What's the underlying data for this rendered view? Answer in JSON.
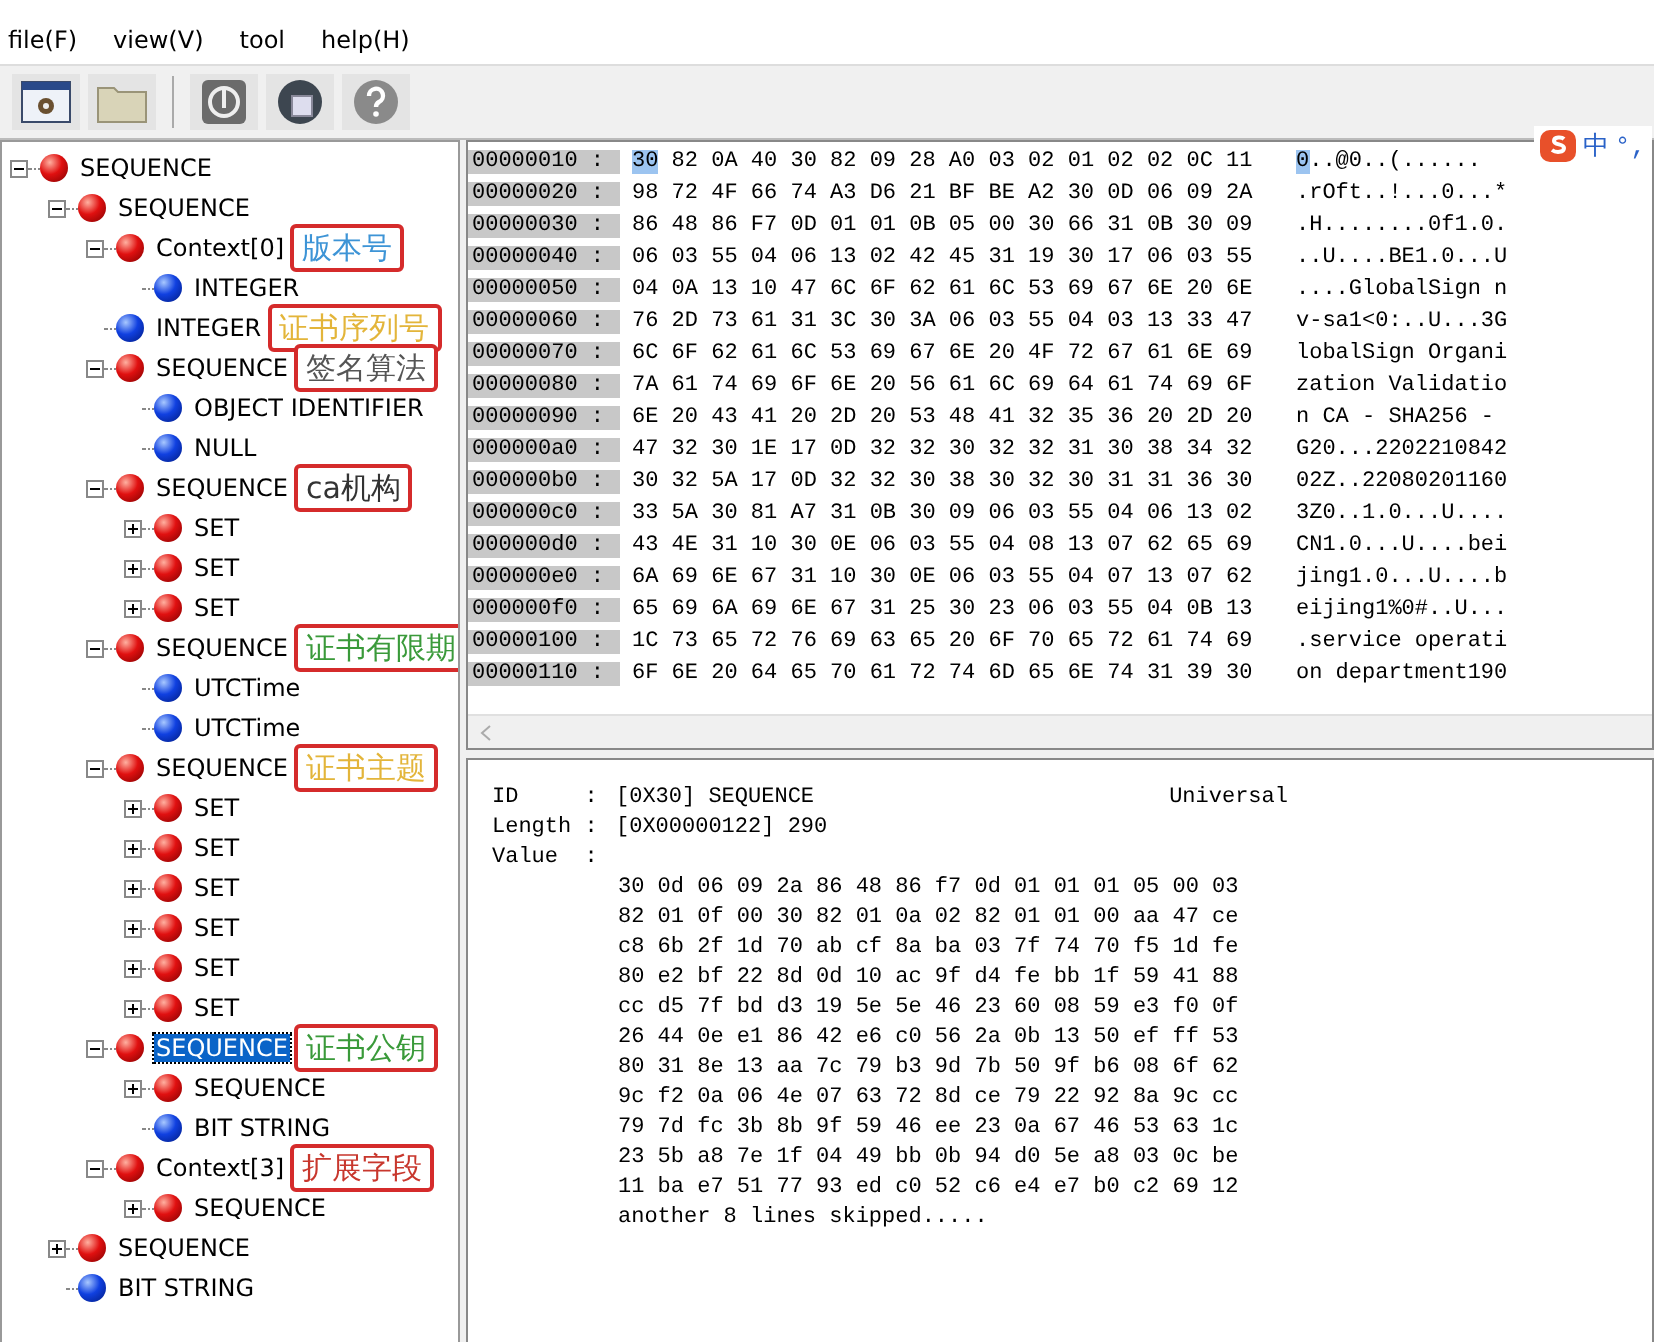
{
  "menu": [
    {
      "label": "file(F)"
    },
    {
      "label": "view(V)"
    },
    {
      "label": "tool"
    },
    {
      "label": "help(H)"
    }
  ],
  "toolbar": [
    {
      "kind": "window"
    },
    {
      "kind": "folder"
    },
    {
      "kind": "power"
    },
    {
      "kind": "disc"
    },
    {
      "kind": "help"
    }
  ],
  "tree": [
    {
      "label": "SEQUENCE",
      "kind": "constructed",
      "expanded": true,
      "selected": false,
      "children": [
        {
          "label": "SEQUENCE",
          "kind": "constructed",
          "expanded": true,
          "selected": false,
          "children": [
            {
              "label": "Context[0]",
              "kind": "constructed",
              "expanded": true,
              "selected": false,
              "note": {
                "text": "版本号",
                "color": "#3d94d6"
              },
              "children": [
                {
                  "label": "INTEGER",
                  "kind": "primitive",
                  "selected": false
                }
              ]
            },
            {
              "label": "INTEGER",
              "kind": "primitive",
              "selected": false,
              "note": {
                "text": "证书序列号",
                "color": "#e3b53a"
              }
            },
            {
              "label": "SEQUENCE",
              "kind": "constructed",
              "expanded": true,
              "selected": false,
              "note": {
                "text": "签名算法",
                "color": "#555555"
              },
              "children": [
                {
                  "label": "OBJECT IDENTIFIER",
                  "kind": "primitive",
                  "selected": false
                },
                {
                  "label": "NULL",
                  "kind": "primitive",
                  "selected": false
                }
              ]
            },
            {
              "label": "SEQUENCE",
              "kind": "constructed",
              "expanded": true,
              "selected": false,
              "note": {
                "text": "ca机构",
                "color": "#333333"
              },
              "children": [
                {
                  "label": "SET",
                  "kind": "constructed",
                  "expanded": false,
                  "selected": false
                },
                {
                  "label": "SET",
                  "kind": "constructed",
                  "expanded": false,
                  "selected": false
                },
                {
                  "label": "SET",
                  "kind": "constructed",
                  "expanded": false,
                  "selected": false
                }
              ]
            },
            {
              "label": "SEQUENCE",
              "kind": "constructed",
              "expanded": true,
              "selected": false,
              "note": {
                "text": "证书有限期",
                "color": "#3a9a3a"
              },
              "children": [
                {
                  "label": "UTCTime",
                  "kind": "primitive",
                  "selected": false
                },
                {
                  "label": "UTCTime",
                  "kind": "primitive",
                  "selected": false
                }
              ]
            },
            {
              "label": "SEQUENCE",
              "kind": "constructed",
              "expanded": true,
              "selected": false,
              "note": {
                "text": "证书主题",
                "color": "#e3b53a"
              },
              "children": [
                {
                  "label": "SET",
                  "kind": "constructed",
                  "expanded": false,
                  "selected": false
                },
                {
                  "label": "SET",
                  "kind": "constructed",
                  "expanded": false,
                  "selected": false
                },
                {
                  "label": "SET",
                  "kind": "constructed",
                  "expanded": false,
                  "selected": false
                },
                {
                  "label": "SET",
                  "kind": "constructed",
                  "expanded": false,
                  "selected": false
                },
                {
                  "label": "SET",
                  "kind": "constructed",
                  "expanded": false,
                  "selected": false
                },
                {
                  "label": "SET",
                  "kind": "constructed",
                  "expanded": false,
                  "selected": false
                }
              ]
            },
            {
              "label": "SEQUENCE",
              "kind": "constructed",
              "expanded": true,
              "selected": true,
              "note": {
                "text": "证书公钥",
                "color": "#3a9a3a"
              },
              "children": [
                {
                  "label": "SEQUENCE",
                  "kind": "constructed",
                  "expanded": false,
                  "selected": false
                },
                {
                  "label": "BIT STRING",
                  "kind": "primitive",
                  "selected": false
                }
              ]
            },
            {
              "label": "Context[3]",
              "kind": "constructed",
              "expanded": true,
              "selected": false,
              "note": {
                "text": "扩展字段",
                "color": "#c8372d"
              },
              "children": [
                {
                  "label": "SEQUENCE",
                  "kind": "constructed",
                  "expanded": false,
                  "selected": false
                }
              ]
            }
          ]
        },
        {
          "label": "SEQUENCE",
          "kind": "constructed",
          "expanded": false,
          "selected": false
        },
        {
          "label": "BIT STRING",
          "kind": "primitive",
          "selected": false
        }
      ]
    }
  ],
  "hex_rows": [
    {
      "offset": "00000010 :",
      "hex": "30 82 0A 40 30 82 09 28 A0 03 02 01 02 02 0C 11",
      "ascii": "0..@0..(......",
      "cursor": true
    },
    {
      "offset": "00000020 :",
      "hex": "98 72 4F 66 74 A3 D6 21 BF BE A2 30 0D 06 09 2A",
      "ascii": ".rOft..!...0...*",
      "cursor": false
    },
    {
      "offset": "00000030 :",
      "hex": "86 48 86 F7 0D 01 01 0B 05 00 30 66 31 0B 30 09",
      "ascii": ".H........0f1.0.",
      "cursor": false
    },
    {
      "offset": "00000040 :",
      "hex": "06 03 55 04 06 13 02 42 45 31 19 30 17 06 03 55",
      "ascii": "..U....BE1.0...U",
      "cursor": false
    },
    {
      "offset": "00000050 :",
      "hex": "04 0A 13 10 47 6C 6F 62 61 6C 53 69 67 6E 20 6E",
      "ascii": "....GlobalSign n",
      "cursor": false
    },
    {
      "offset": "00000060 :",
      "hex": "76 2D 73 61 31 3C 30 3A 06 03 55 04 03 13 33 47",
      "ascii": "v-sa1<0:..U...3G",
      "cursor": false
    },
    {
      "offset": "00000070 :",
      "hex": "6C 6F 62 61 6C 53 69 67 6E 20 4F 72 67 61 6E 69",
      "ascii": "lobalSign Organi",
      "cursor": false
    },
    {
      "offset": "00000080 :",
      "hex": "7A 61 74 69 6F 6E 20 56 61 6C 69 64 61 74 69 6F",
      "ascii": "zation Validatio",
      "cursor": false
    },
    {
      "offset": "00000090 :",
      "hex": "6E 20 43 41 20 2D 20 53 48 41 32 35 36 20 2D 20",
      "ascii": "n CA - SHA256 - ",
      "cursor": false
    },
    {
      "offset": "000000a0 :",
      "hex": "47 32 30 1E 17 0D 32 32 30 32 32 31 30 38 34 32",
      "ascii": "G20...2202210842",
      "cursor": false
    },
    {
      "offset": "000000b0 :",
      "hex": "30 32 5A 17 0D 32 32 30 38 30 32 30 31 31 36 30",
      "ascii": "02Z..22080201160",
      "cursor": false
    },
    {
      "offset": "000000c0 :",
      "hex": "33 5A 30 81 A7 31 0B 30 09 06 03 55 04 06 13 02",
      "ascii": "3Z0..1.0...U....",
      "cursor": false
    },
    {
      "offset": "000000d0 :",
      "hex": "43 4E 31 10 30 0E 06 03 55 04 08 13 07 62 65 69",
      "ascii": "CN1.0...U....bei",
      "cursor": false
    },
    {
      "offset": "000000e0 :",
      "hex": "6A 69 6E 67 31 10 30 0E 06 03 55 04 07 13 07 62",
      "ascii": "jing1.0...U....b",
      "cursor": false
    },
    {
      "offset": "000000f0 :",
      "hex": "65 69 6A 69 6E 67 31 25 30 23 06 03 55 04 0B 13",
      "ascii": "eijing1%0#..U...",
      "cursor": false
    },
    {
      "offset": "00000100 :",
      "hex": "1C 73 65 72 76 69 63 65 20 6F 70 65 72 61 74 69",
      "ascii": ".service operati",
      "cursor": false
    },
    {
      "offset": "00000110 :",
      "hex": "6F 6E 20 64 65 70 61 72 74 6D 65 6E 74 31 39 30",
      "ascii": "on department190",
      "cursor": false
    }
  ],
  "ime_bar": {
    "labels": [
      "中",
      "°,"
    ]
  },
  "detail": {
    "id_label": "ID     :",
    "id_value": "[0X30] SEQUENCE",
    "class": "Universal",
    "length_label": "Length :",
    "length_value": "[0X00000122] 290",
    "value_label": "Value  :",
    "value_lines": [
      "30 0d 06 09 2a 86 48 86 f7 0d 01 01 01 05 00 03",
      "82 01 0f 00 30 82 01 0a 02 82 01 01 00 aa 47 ce",
      "c8 6b 2f 1d 70 ab cf 8a ba 03 7f 74 70 f5 1d fe",
      "80 e2 bf 22 8d 0d 10 ac 9f d4 fe bb 1f 59 41 88",
      "cc d5 7f bd d3 19 5e 5e 46 23 60 08 59 e3 f0 0f",
      "26 44 0e e1 86 42 e6 c0 56 2a 0b 13 50 ef ff 53",
      "80 31 8e 13 aa 7c 79 b3 9d 7b 50 9f b6 08 6f 62",
      "9c f2 0a 06 4e 07 63 72 8d ce 79 22 92 8a 9c cc",
      "79 7d fc 3b 8b 9f 59 46 ee 23 0a 67 46 53 63 1c",
      "23 5b a8 7e 1f 04 49 bb 0b 94 d0 5e a8 03 0c be",
      "11 ba e7 51 77 93 ed c0 52 c6 e4 e7 b0 c2 69 12"
    ],
    "footer": "another 8 lines skipped....."
  }
}
